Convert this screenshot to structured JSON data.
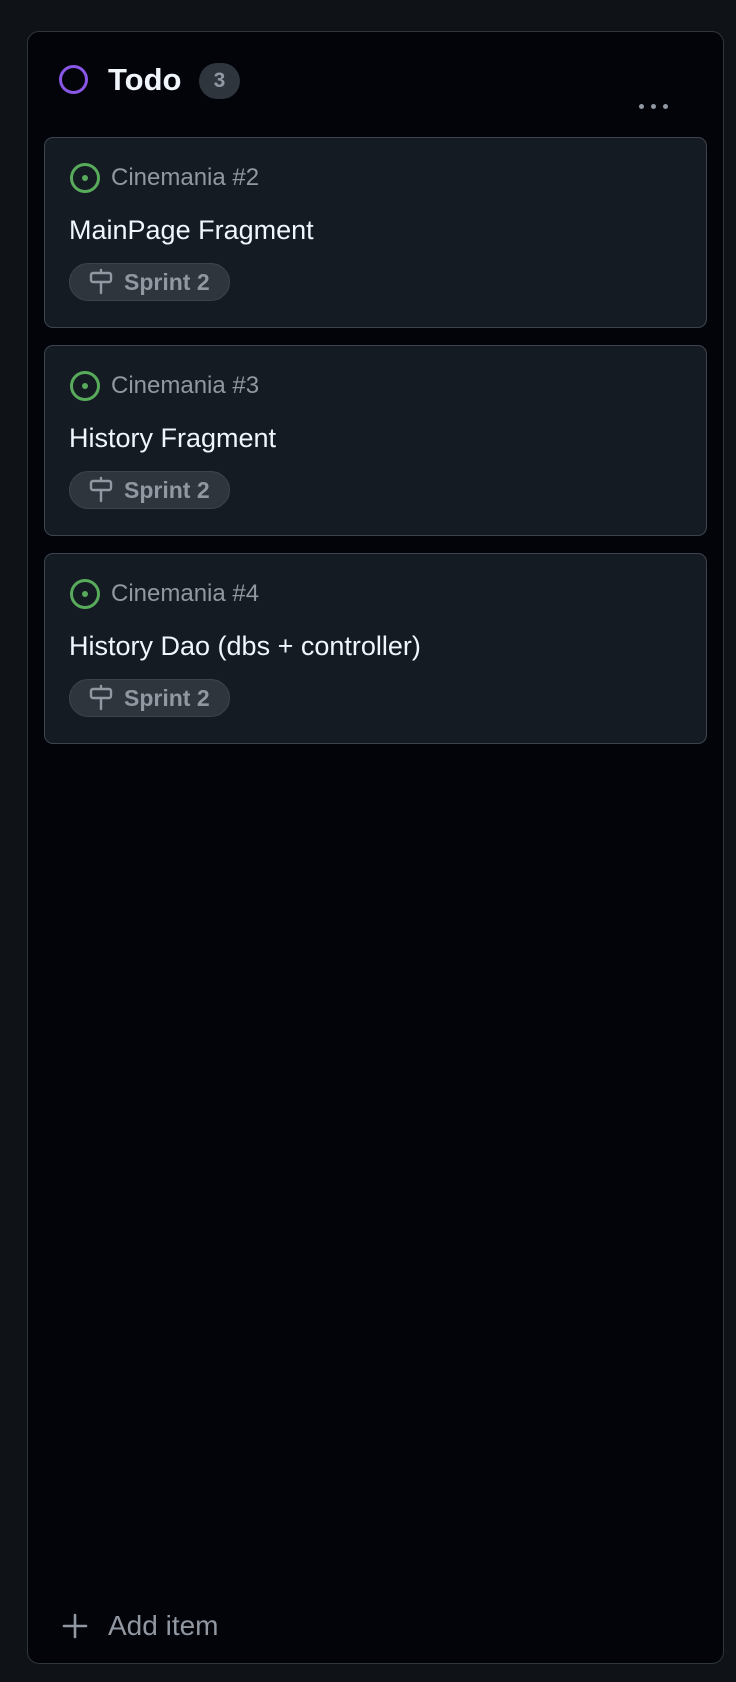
{
  "column": {
    "title": "Todo",
    "count": "3",
    "status_color": "#8957e5"
  },
  "cards": [
    {
      "reference": "Cinemania #2",
      "title": "MainPage Fragment",
      "milestone": "Sprint 2",
      "status_icon": "issue-open-icon"
    },
    {
      "reference": "Cinemania #3",
      "title": "History Fragment",
      "milestone": "Sprint 2",
      "status_icon": "issue-open-icon"
    },
    {
      "reference": "Cinemania #4",
      "title": "History Dao (dbs + controller)",
      "milestone": "Sprint 2",
      "status_icon": "issue-open-icon"
    }
  ],
  "footer": {
    "add_label": "Add item"
  },
  "colors": {
    "open_issue": "#57ab5a",
    "card_bg": "#151b23",
    "column_bg": "#02040a",
    "page_bg": "#0f1217"
  }
}
